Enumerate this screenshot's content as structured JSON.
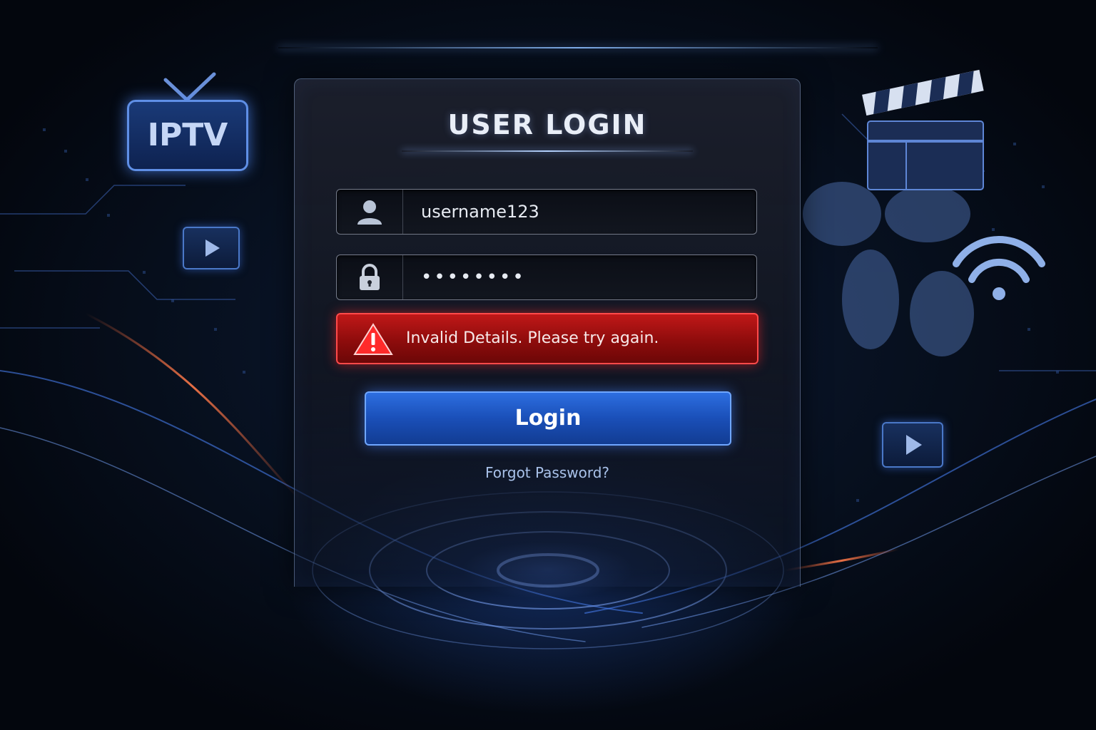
{
  "login": {
    "title": "USER LOGIN",
    "username_value": "username123",
    "password_value": "••••••••",
    "error_message": "Invalid Details. Please try again.",
    "login_label": "Login",
    "forgot_label": "Forgot Password?"
  },
  "decor": {
    "badge_text": "IPTV"
  },
  "colors": {
    "accent_blue": "#1a4fb8",
    "error_red": "#c01818",
    "background": "#07101f"
  }
}
